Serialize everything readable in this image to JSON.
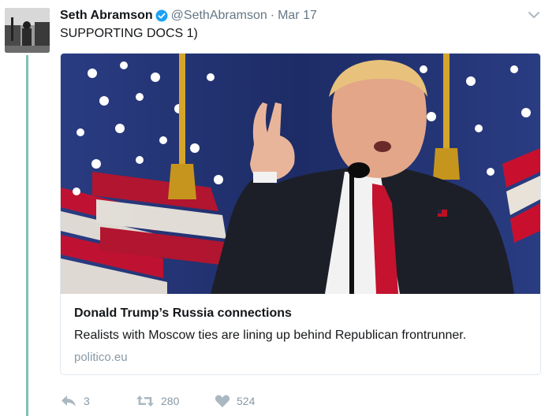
{
  "tweet": {
    "author_name": "Seth Abramson",
    "handle": "@SethAbramson",
    "separator": "·",
    "date": "Mar 17",
    "text": "SUPPORTING DOCS 1)"
  },
  "card": {
    "title": "Donald Trump’s Russia connections",
    "description": "Realists with Moscow ties are lining up behind Republican frontrunner.",
    "domain": "politico.eu"
  },
  "actions": {
    "reply_count": "3",
    "retweet_count": "280",
    "like_count": "524"
  },
  "icons": {
    "verified": "verified-badge-icon",
    "caret": "chevron-down-icon",
    "reply": "reply-icon",
    "retweet": "retweet-icon",
    "like": "heart-icon"
  },
  "colors": {
    "verified": "#1da1f2",
    "thread_line": "#7fc1b8",
    "secondary_text": "#657786",
    "action_gray": "#8899a6"
  }
}
